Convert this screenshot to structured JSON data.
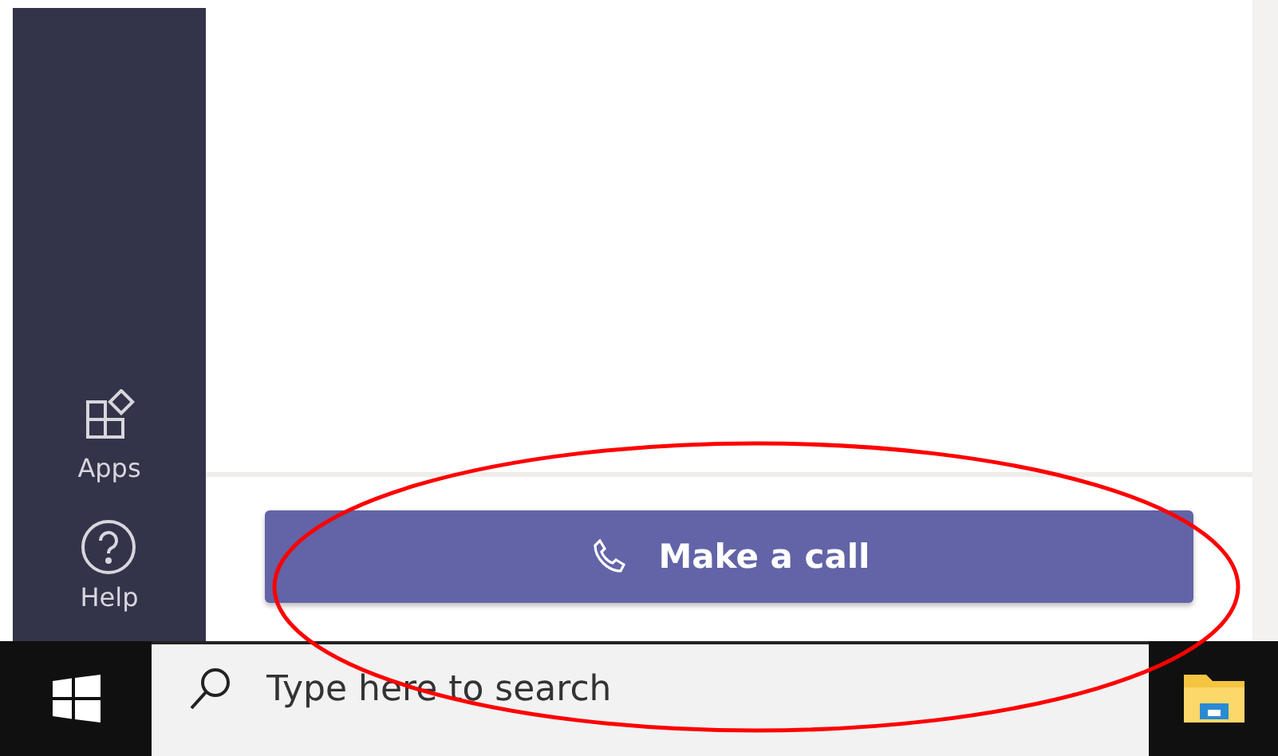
{
  "sidebar": {
    "items": [
      {
        "label": "Apps",
        "kind": "apps"
      },
      {
        "label": "Help",
        "kind": "help"
      }
    ]
  },
  "call_button": {
    "label": "Make a call"
  },
  "taskbar": {
    "search": {
      "placeholder": "Type here to search"
    }
  },
  "annotation": {
    "kind": "ellipse",
    "color": "#ff0000"
  }
}
